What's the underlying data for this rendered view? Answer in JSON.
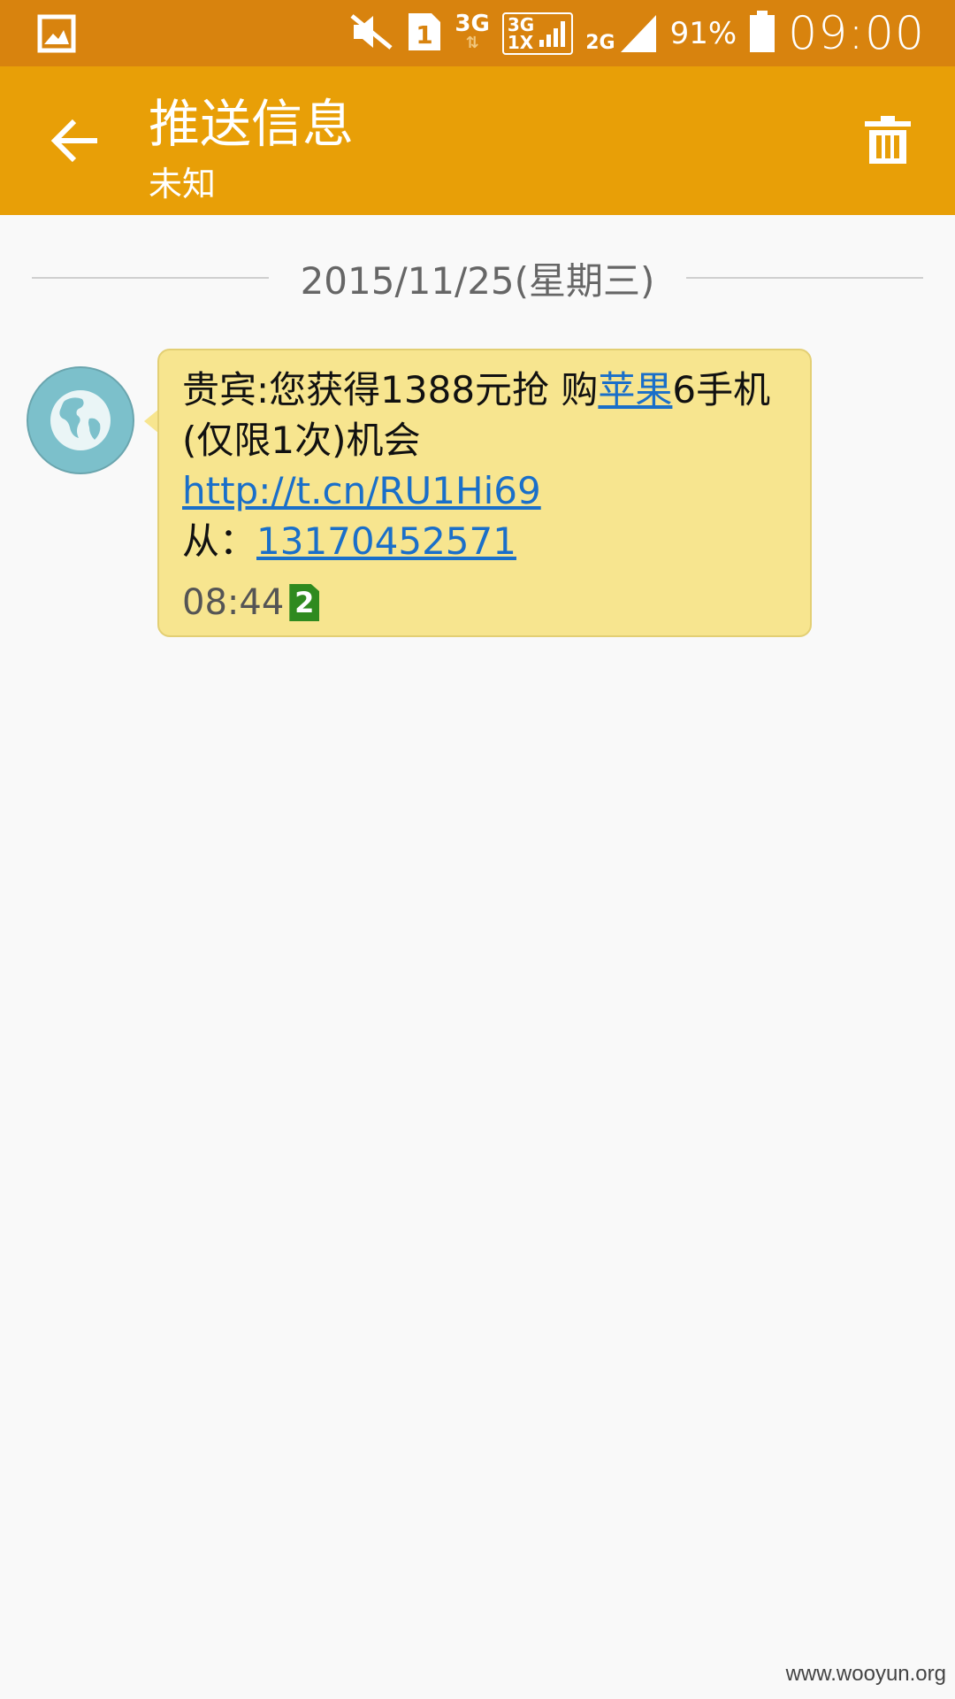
{
  "status_bar": {
    "notification_icon": "image-icon",
    "mute_icon": "vibrate-off-icon",
    "sim_label": "1",
    "net1": "3G",
    "net_box_top": "3G",
    "net_box_bottom": "1X",
    "net2": "2G",
    "battery_percent": "91%",
    "time": "09:00"
  },
  "app_bar": {
    "back_icon": "arrow-back-icon",
    "title": "推送信息",
    "subtitle": "未知",
    "delete_icon": "trash-icon"
  },
  "conversation": {
    "date": "2015/11/25(星期三)",
    "message": {
      "avatar_icon": "globe-icon",
      "text_part1": "贵宾:您获得1388元抢 购",
      "link_word": "苹果",
      "text_part2": "6手机(仅限1次)机会",
      "url": "http://t.cn/RU1Hi69",
      "from_label": "从：",
      "from_number": "13170452571",
      "time": "08:44",
      "sim_badge": "2"
    }
  },
  "watermark": "www.wooyun.org",
  "colors": {
    "status_bar": "#d8830e",
    "app_bar": "#e89f07",
    "bubble": "#f7e58f",
    "link": "#1a6fc9",
    "sim_badge": "#2f8a1f"
  }
}
